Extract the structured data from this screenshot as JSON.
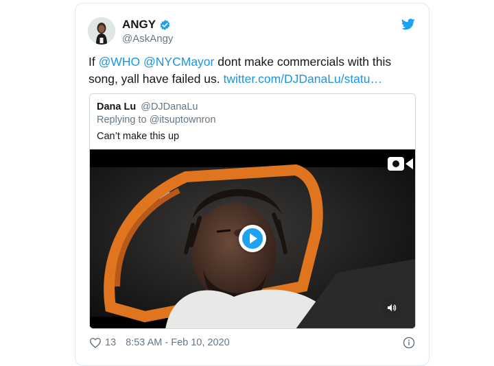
{
  "author": {
    "display_name": "ANGY",
    "handle": "@AskAngy",
    "avatar_icon": "profile-avatar",
    "verified_icon": "verified-badge-icon"
  },
  "tweet": {
    "mention_1": "@WHO",
    "mention_2": "@NYCMayor",
    "text_1": "If",
    "text_2": "dont make commercials with this song, yall have failed us.",
    "link": "twitter.com/DJDanaLu/statu…"
  },
  "quote": {
    "display_name": "Dana Lu",
    "handle": "@DJDanaLu",
    "replying": "Replying to @itsuptownron",
    "text": "Can’t make this up"
  },
  "footer": {
    "likes": "13",
    "timestamp": "8:53 AM - Feb 10, 2020"
  },
  "colors": {
    "link": "#1b95e0",
    "twitter_blue": "#1da1f2",
    "muted": "#657786"
  }
}
